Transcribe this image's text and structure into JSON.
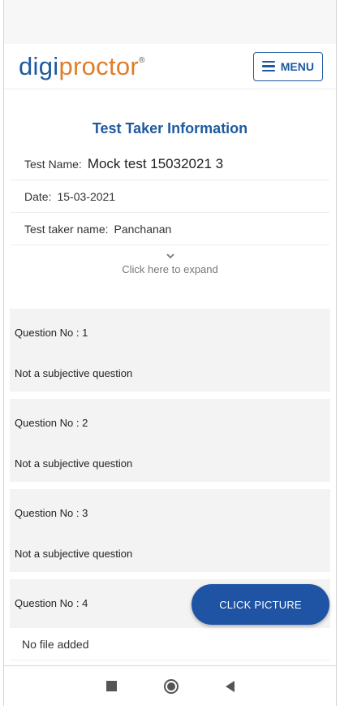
{
  "header": {
    "logo_part1": "digi",
    "logo_part2": "proctor",
    "logo_reg": "®",
    "menu_label": "MENU"
  },
  "section": {
    "title": "Test Taker Information"
  },
  "info": {
    "test_name_label": "Test Name:",
    "test_name_value": "Mock test 15032021 3",
    "date_label": "Date:",
    "date_value": "15-03-2021",
    "taker_label": "Test taker name:",
    "taker_value": "Panchanan"
  },
  "expand": {
    "text": "Click here to expand"
  },
  "questions": [
    {
      "number": "Question No : 1",
      "note": "Not a subjective question"
    },
    {
      "number": "Question No : 2",
      "note": "Not a subjective question"
    },
    {
      "number": "Question No : 3",
      "note": "Not a subjective question"
    },
    {
      "number": "Question No : 4"
    }
  ],
  "upload": {
    "status": "No file added",
    "button_label": "CLICK PICTURE"
  },
  "colors": {
    "brand_blue": "#1e5aa0",
    "brand_orange": "#e07d2a",
    "fab_blue": "#1f53a3"
  },
  "icons": {
    "menu": "hamburger-icon",
    "expand": "chevron-down-icon",
    "nav_recents": "square-icon",
    "nav_home": "circle-icon",
    "nav_back": "triangle-back-icon"
  }
}
